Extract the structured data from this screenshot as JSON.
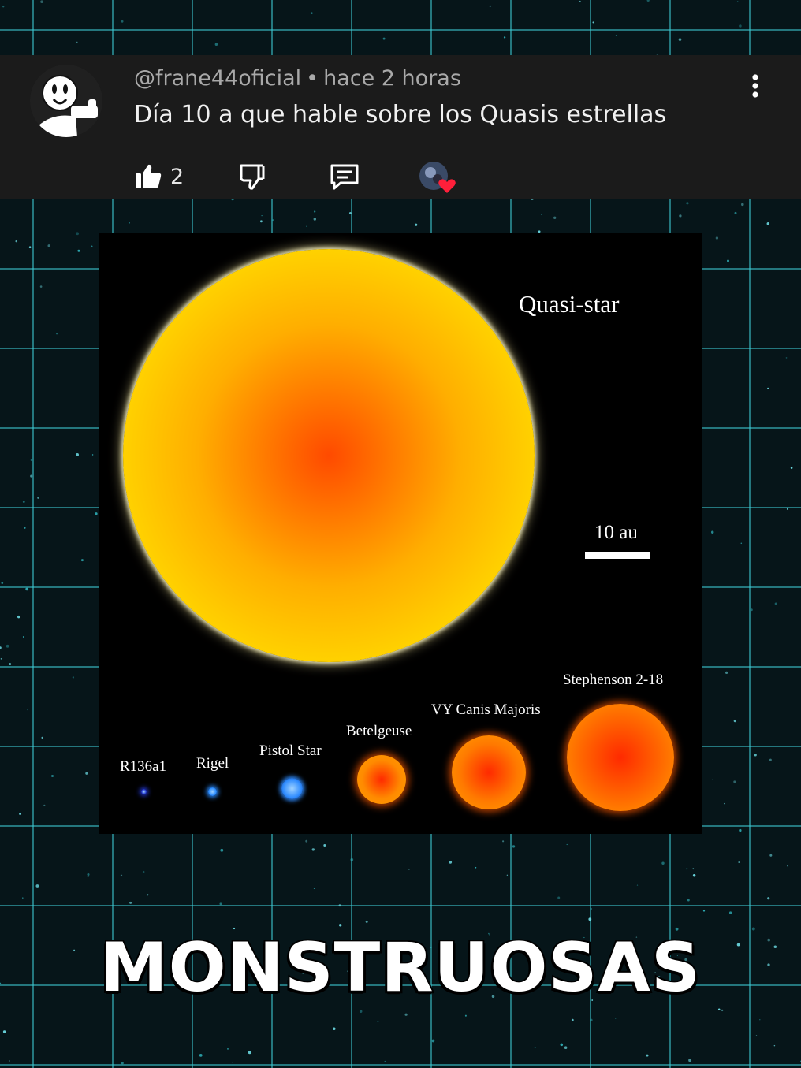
{
  "comment": {
    "username": "@frane44oficial",
    "separator": "•",
    "time": "hace 2 horas",
    "text": "Día 10 a que hable sobre los Quasis estrellas",
    "likes": "2",
    "icons": {
      "like": "thumbs-up-icon",
      "dislike": "thumbs-down-icon",
      "reply": "comment-icon",
      "more": "more-vertical-icon",
      "hearted": "creator-heart-icon"
    }
  },
  "figure": {
    "main_label": "Quasi-star",
    "scale_label": "10 au",
    "stars": [
      {
        "name": "R136a1",
        "color": "#2236d0"
      },
      {
        "name": "Rigel",
        "color": "#2a8cff"
      },
      {
        "name": "Pistol Star",
        "color": "#2f8cff"
      },
      {
        "name": "Betelgeuse",
        "color": "#ff8a00"
      },
      {
        "name": "VY Canis Majoris",
        "color": "#ff7a00"
      },
      {
        "name": "Stephenson 2-18",
        "color": "#ff6a00"
      }
    ],
    "quasi_star_colors": [
      "#ff4a00",
      "#ffae00",
      "#ffee00"
    ]
  },
  "caption": "MONSTRUOSAS"
}
